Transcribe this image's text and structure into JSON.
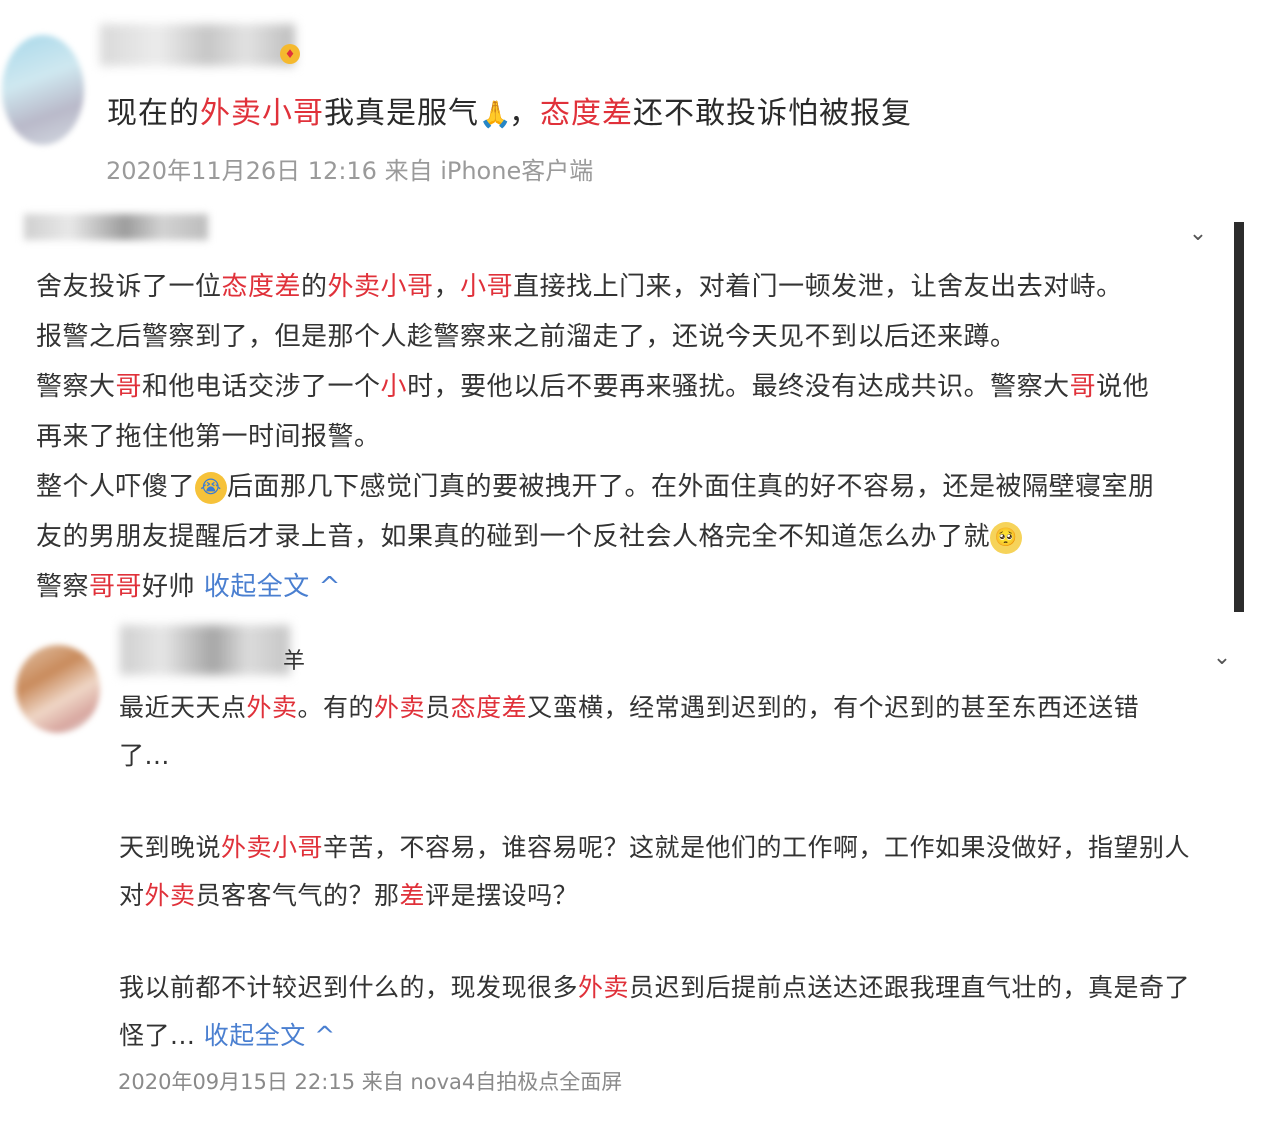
{
  "post1": {
    "text": {
      "p1": "现在的",
      "h1": "外卖小哥",
      "p2": "我真是服气",
      "p3": "，",
      "h2": "态度差",
      "p4": "还不敢投诉怕被报复"
    },
    "meta": "2020年11月26日 12:16  来自 iPhone客户端",
    "pray_icon": "pray-emoji"
  },
  "post2": {
    "lines": {
      "l1": {
        "a": "舍友投诉了一位",
        "b": "态度差",
        "c": "的",
        "d": "外卖小哥",
        "e": "，",
        "f": "小哥",
        "g": "直接找上门来，对着门一顿发泄，让舍友出去对峙。"
      },
      "l2": "报警之后警察到了，但是那个人趁警察来之前溜走了，还说今天见不到以后还来蹲。",
      "l3": {
        "a": "警察大",
        "b": "哥",
        "c": "和他电话交涉了一个",
        "d": "小",
        "e": "时，要他以后不要再来骚扰。最终没有达成共识。警察大",
        "f": "哥",
        "g": "说他"
      },
      "l4": "再来了拖住他第一时间报警。",
      "l5": {
        "a": "整个人吓傻了",
        "b": "后面那几下感觉门真的要被拽开了。在外面住真的好不容易，还是被隔壁寝室朋"
      },
      "l6": "友的男朋友提醒后才录上音，如果真的碰到一个反社会人格完全不知道怎么办了就",
      "l7": {
        "a": "警察",
        "b": "哥哥",
        "c": "好帅 ",
        "link": "收起全文"
      }
    },
    "collapse_icon": "chevron-up"
  },
  "post3": {
    "name_tail": "羊",
    "lines": {
      "l1": {
        "a": "最近天天点",
        "b": "外卖",
        "c": "。有的",
        "d": "外卖",
        "e": "员",
        "f": "态度差",
        "g": "又蛮横，经常遇到迟到的，有个迟到的甚至东西还送错"
      },
      "l2": "了...",
      "l3": {
        "a": "天到晚说",
        "b": "外卖小哥",
        "c": "辛苦，不容易，谁容易呢？这就是他们的工作啊，工作如果没做好，指望别人"
      },
      "l4": {
        "a": "对",
        "b": "外卖",
        "c": "员客客气气的？那",
        "d": "差",
        "e": "评是摆设吗？"
      },
      "l5": {
        "a": "我以前都不计较迟到什么的，现发现很多",
        "b": "外卖",
        "c": "员迟到后提前点送达还跟我理直气壮的，真是奇了"
      },
      "l6": {
        "a": "怪了... ",
        "link": "收起全文"
      }
    },
    "meta": "2020年09月15日 22:15  来自 nova4自拍极点全面屏"
  },
  "colors": {
    "highlight": "#e0313a",
    "link": "#4a7fd0",
    "meta": "#9a9a9a"
  }
}
